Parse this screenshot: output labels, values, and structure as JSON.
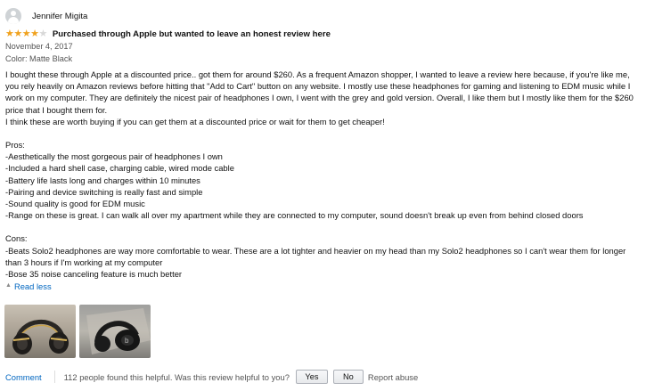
{
  "review": {
    "reviewer_name": "Jennifer Migita",
    "rating": 4,
    "rating_max": 5,
    "headline": "Purchased through Apple but wanted to leave an honest review here",
    "date": "November 4, 2017",
    "variant": "Color: Matte Black",
    "paragraph1": "I bought these through Apple at a discounted price.. got them for around $260. As a frequent Amazon shopper, I wanted to leave a review here because, if you're like me, you rely heavily on Amazon reviews before hitting that \"Add to Cart\" button on any website. I mostly use these headphones for gaming and listening to EDM music while I work on my computer. They are definitely the nicest pair of headphones I own, I went with the grey and gold version. Overall, I like them but I mostly like them for the $260 price that I bought them for.",
    "paragraph2": "I think these are worth buying if you can get them at a discounted price or wait for them to get cheaper!",
    "pros_title": "Pros:",
    "pros": [
      "-Aesthetically the most gorgeous pair of headphones I own",
      "-Included a hard shell case, charging cable, wired mode cable",
      "-Battery life lasts long and charges within 10 minutes",
      "-Pairing and device switching is really fast and simple",
      "-Sound quality is good for EDM music",
      "-Range on these is great. I can walk all over my apartment while they are connected to my computer, sound doesn't break up even from behind closed doors"
    ],
    "cons_title": "Cons:",
    "cons": [
      "-Beats Solo2 headphones are way more comfortable to wear. These are a lot tighter and heavier on my head than my Solo2 headphones so I can't wear them for longer than 3 hours if I'm working at my computer",
      "-Bose 35 noise canceling feature is much better"
    ],
    "read_less_label": "Read less",
    "photos": [
      "headphones-photo-gold",
      "headphones-photo-black"
    ]
  },
  "actions": {
    "comment_label": "Comment",
    "helpful_text": "112 people found this helpful. Was this review helpful to you?",
    "yes_label": "Yes",
    "no_label": "No",
    "report_label": "Report abuse"
  },
  "colors": {
    "star_filled": "#f0a21e",
    "star_empty": "#d8d8d8",
    "link": "#0066c0"
  }
}
